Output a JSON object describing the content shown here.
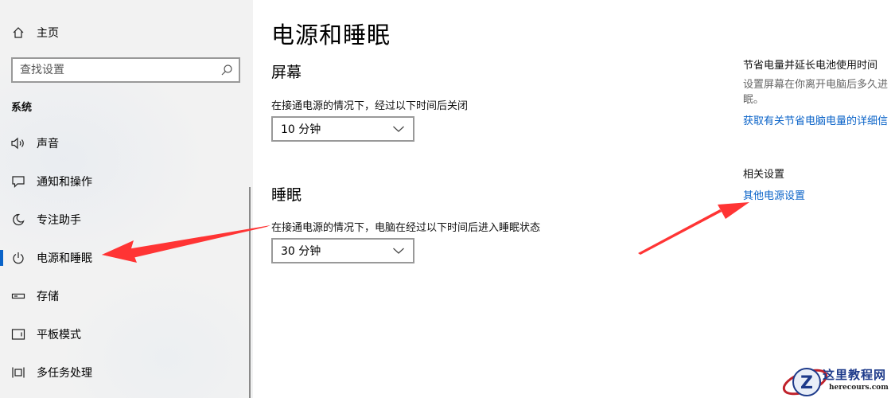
{
  "sidebar": {
    "home_label": "主页",
    "search_placeholder": "查找设置",
    "section_label": "系统",
    "items": [
      {
        "label": "声音",
        "icon": "speaker-icon"
      },
      {
        "label": "通知和操作",
        "icon": "notification-icon"
      },
      {
        "label": "专注助手",
        "icon": "moon-icon"
      },
      {
        "label": "电源和睡眠",
        "icon": "power-icon",
        "active": true
      },
      {
        "label": "存储",
        "icon": "storage-icon"
      },
      {
        "label": "平板模式",
        "icon": "tablet-icon"
      },
      {
        "label": "多任务处理",
        "icon": "multitask-icon"
      }
    ]
  },
  "main": {
    "title": "电源和睡眠",
    "screen": {
      "heading": "屏幕",
      "description": "在接通电源的情况下，经过以下时间后关闭",
      "value": "10 分钟"
    },
    "sleep": {
      "heading": "睡眠",
      "description": "在接通电源的情况下，电脑在经过以下时间后进入睡眠状态",
      "value": "30 分钟"
    }
  },
  "right_panel": {
    "save_title": "节省电量并延长电池使用时间",
    "save_text_line1": "设置屏幕在你离开电脑后多久进",
    "save_text_line2": "眠。",
    "save_link": "获取有关节省电脑电量的详细信",
    "related_title": "相关设置",
    "related_link": "其他电源设置"
  },
  "watermark": {
    "title": "这里教程网",
    "subtitle": "herecours.com",
    "logo_letter": "Z"
  },
  "colors": {
    "accent": "#0a63c8",
    "sidebar_bg": "#f2f2f2",
    "annotation": "#ff3030"
  }
}
